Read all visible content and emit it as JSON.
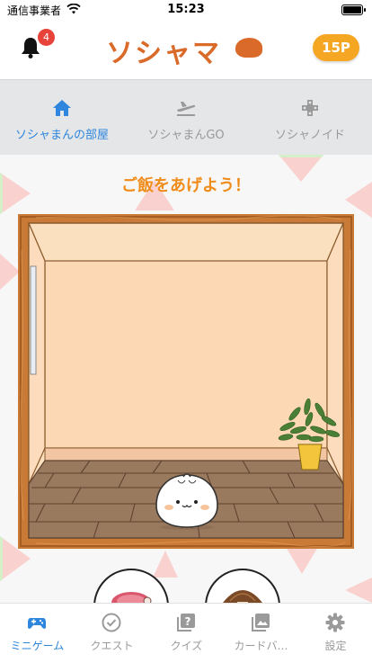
{
  "status_bar": {
    "carrier": "通信事業者",
    "time": "15:23"
  },
  "header": {
    "notification_count": "4",
    "logo_text": "ソシャマ",
    "points": "15P"
  },
  "top_tabs": [
    {
      "label": "ソシャまんの部屋",
      "icon": "home-icon",
      "active": true
    },
    {
      "label": "ソシャまんGO",
      "icon": "plane-icon",
      "active": false
    },
    {
      "label": "ソシャノイド",
      "icon": "gamepad-icon",
      "active": false
    }
  ],
  "room": {
    "title": "ご飯をあげよう！"
  },
  "action_buttons": [
    {
      "name": "meat-button",
      "icon": "meat-icon"
    },
    {
      "name": "mushroom-button",
      "icon": "mushroom-icon"
    }
  ],
  "bottom_nav": [
    {
      "label": "ミニゲーム",
      "icon": "gamepad-icon",
      "active": true
    },
    {
      "label": "クエスト",
      "icon": "check-circle-icon",
      "active": false
    },
    {
      "label": "クイズ",
      "icon": "quiz-icon",
      "active": false
    },
    {
      "label": "カードバ…",
      "icon": "image-card-icon",
      "active": false
    },
    {
      "label": "設定",
      "icon": "gear-icon",
      "active": false
    }
  ],
  "colors": {
    "accent": "#2e86de",
    "brand": "#d96a2a",
    "points": "#f5a623",
    "badge": "#e8433a",
    "room_title": "#f08c1a"
  }
}
